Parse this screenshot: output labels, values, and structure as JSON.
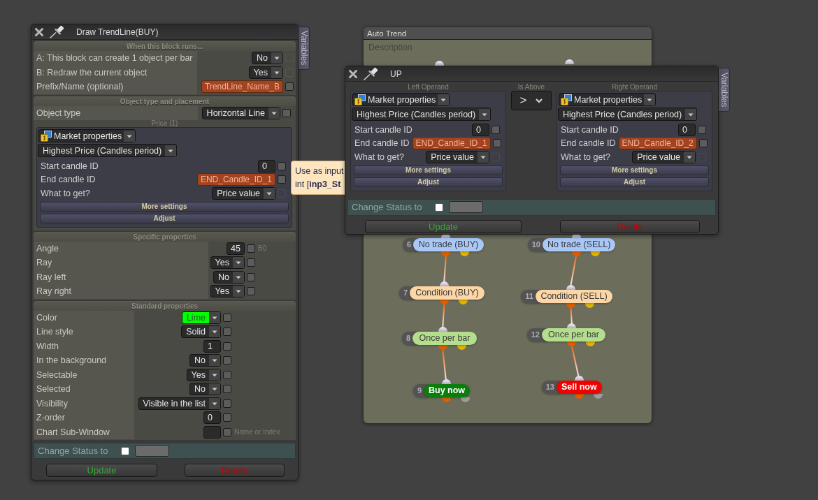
{
  "block_panel": {
    "title": "Draw TrendLine(BUY)",
    "side_tab": "Variables",
    "sections": [
      {
        "heading": "When this block runs...",
        "rows": [
          {
            "label": "A: This block can create 1 object per bar",
            "field": {
              "kind": "dropdown",
              "value": "No"
            },
            "checked": false,
            "checkbox_disabled": true
          },
          {
            "label": "B: Redraw the current object",
            "field": {
              "kind": "dropdown",
              "value": "Yes"
            },
            "checked": false,
            "checkbox_disabled": true
          },
          {
            "label": "Prefix/Name (optional)",
            "field": {
              "kind": "variable",
              "value": "TrendLine_Name_B"
            },
            "checked": false,
            "checkbox_disabled": false
          }
        ]
      },
      {
        "heading": "Object type and placement",
        "rows": [
          {
            "label": "Object type",
            "field": {
              "kind": "dropdown",
              "value": "Horizontal Line"
            },
            "checked": false,
            "checkbox_disabled": false
          }
        ],
        "operands": [
          {
            "caption": "Price (1)",
            "source": "Market properties",
            "function": "Highest Price (Candles period)",
            "params": [
              {
                "label": "Start candle ID",
                "field": {
                  "kind": "input",
                  "value": "0"
                },
                "checked": false,
                "checkbox_disabled": false
              },
              {
                "label": "End candle ID",
                "field": {
                  "kind": "variable",
                  "value": "END_Candle_ID_1"
                },
                "checked": false,
                "checkbox_disabled": false
              },
              {
                "label": "What to get?",
                "field": {
                  "kind": "dropdown",
                  "value": "Price value"
                },
                "checked": false,
                "checkbox_disabled": true
              }
            ],
            "buttons": [
              "More settings",
              "Adjust"
            ]
          }
        ]
      },
      {
        "heading": "Specific properties",
        "rows": [
          {
            "label": "Angle",
            "field": {
              "kind": "input",
              "value": "45"
            },
            "checked": false,
            "checkbox_disabled": false,
            "note": "B0"
          },
          {
            "label": "Ray",
            "field": {
              "kind": "dropdown",
              "value": "Yes"
            },
            "checked": false,
            "checkbox_disabled": false
          },
          {
            "label": "Ray left",
            "field": {
              "kind": "dropdown",
              "value": "No"
            },
            "checked": false,
            "checkbox_disabled": false
          },
          {
            "label": "Ray right",
            "field": {
              "kind": "dropdown",
              "value": "Yes"
            },
            "checked": false,
            "checkbox_disabled": false
          }
        ]
      },
      {
        "heading": "Standard properties",
        "rows": [
          {
            "label": "Color",
            "field": {
              "kind": "color",
              "value": "Lime",
              "color": "#00ff00"
            },
            "checked": false,
            "checkbox_disabled": false
          },
          {
            "label": "Line style",
            "field": {
              "kind": "dropdown",
              "value": "Solid"
            },
            "checked": false,
            "checkbox_disabled": false
          },
          {
            "label": "Width",
            "field": {
              "kind": "input",
              "value": "1"
            },
            "checked": false,
            "checkbox_disabled": false
          },
          {
            "label": "In the background",
            "field": {
              "kind": "dropdown",
              "value": "No"
            },
            "checked": false,
            "checkbox_disabled": false
          },
          {
            "label": "Selectable",
            "field": {
              "kind": "dropdown",
              "value": "Yes"
            },
            "checked": false,
            "checkbox_disabled": false
          },
          {
            "label": "Selected",
            "field": {
              "kind": "dropdown",
              "value": "No"
            },
            "checked": false,
            "checkbox_disabled": false
          },
          {
            "label": "Visibility",
            "field": {
              "kind": "dropdown",
              "value": "Visible in the list"
            },
            "checked": false,
            "checkbox_disabled": false
          },
          {
            "label": "Z-order",
            "field": {
              "kind": "input",
              "value": "0"
            },
            "checked": false,
            "checkbox_disabled": false
          },
          {
            "label": "Chart Sub-Window",
            "field": {
              "kind": "input"
            },
            "checked": false,
            "checkbox_disabled": false,
            "note": "Name or Index"
          }
        ]
      }
    ],
    "change_status": {
      "label": "Change Status to",
      "checked": false
    },
    "buttons": [
      {
        "label": "Update",
        "kind": "update"
      },
      {
        "label": "Delete",
        "kind": "delete"
      }
    ]
  },
  "tooltip": {
    "lines": [
      "Use as input",
      "int [**inp3_St**"
    ]
  },
  "canvas": {
    "title": "Auto Trend",
    "description": "Description",
    "chains": [
      [
        {
          "number": "6",
          "label": "No trade (BUY)",
          "kind": "block",
          "color": "#a9c8f7"
        },
        {
          "number": "7",
          "label": "Condition (BUY)",
          "kind": "block",
          "color": "#fcd6a6"
        },
        {
          "number": "8",
          "label": "Once per bar",
          "kind": "block",
          "color": "#b4de8d"
        },
        {
          "number": "9",
          "label": "Buy now",
          "kind": "action",
          "color": "#0b7d0b"
        }
      ],
      [
        {
          "number": "10",
          "label": "No trade (SELL)",
          "kind": "block",
          "color": "#a9c8f7"
        },
        {
          "number": "11",
          "label": "Condition (SELL)",
          "kind": "block",
          "color": "#fcd6a6"
        },
        {
          "number": "12",
          "label": "Once per bar",
          "kind": "block",
          "color": "#b4de8d"
        },
        {
          "number": "13",
          "label": "Sell now",
          "kind": "action",
          "color": "#f00000"
        }
      ]
    ]
  },
  "condition_dialog": {
    "title": "UP",
    "side_tab": "Variables",
    "operator": {
      "caption": "Is Above",
      "value": ">"
    },
    "operands": [
      {
        "caption": "Left Operand",
        "source": "Market properties",
        "function": "Highest Price (Candles period)",
        "params": [
          {
            "label": "Start candle ID",
            "field": {
              "kind": "input",
              "value": "0"
            },
            "checked": false,
            "checkbox_disabled": false
          },
          {
            "label": "End candle ID",
            "field": {
              "kind": "variable",
              "value": "END_Candle_ID_1"
            },
            "checked": false,
            "checkbox_disabled": false
          },
          {
            "label": "What to get?",
            "field": {
              "kind": "dropdown",
              "value": "Price value"
            },
            "checked": false,
            "checkbox_disabled": true
          }
        ],
        "buttons": [
          "More settings",
          "Adjust"
        ]
      },
      {
        "caption": "Right Operand",
        "source": "Market properties",
        "function": "Highest Price (Candles period)",
        "params": [
          {
            "label": "Start candle ID",
            "field": {
              "kind": "input",
              "value": "0"
            },
            "checked": false,
            "checkbox_disabled": false
          },
          {
            "label": "End candle ID",
            "field": {
              "kind": "variable",
              "value": "END_Candle_ID_2"
            },
            "checked": false,
            "checkbox_disabled": false
          },
          {
            "label": "What to get?",
            "field": {
              "kind": "dropdown",
              "value": "Price value"
            },
            "checked": false,
            "checkbox_disabled": true
          }
        ],
        "buttons": [
          "More settings",
          "Adjust"
        ]
      }
    ],
    "change_status": {
      "label": "Change Status to",
      "checked": false
    },
    "buttons": [
      {
        "label": "Update",
        "kind": "update"
      },
      {
        "label": "Delete",
        "kind": "delete"
      }
    ]
  }
}
